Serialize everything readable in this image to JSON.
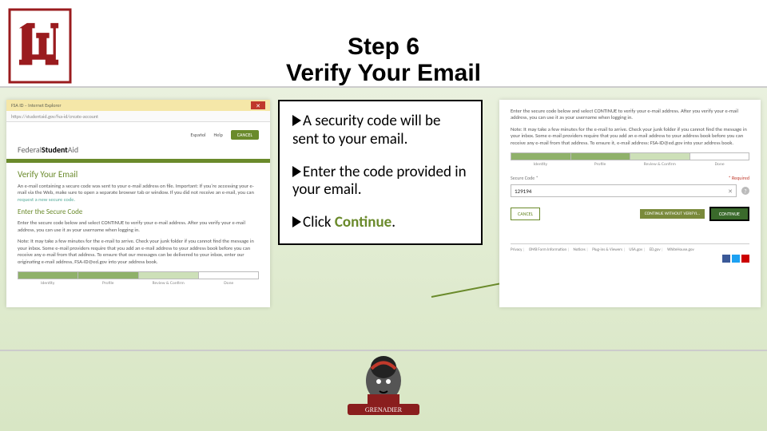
{
  "header": {
    "step": "Step 6",
    "title": "Verify Your Email"
  },
  "bullets": {
    "b1": "A security code will be sent to your email.",
    "b2": "Enter the code provided in your email.",
    "b3_prefix": "Click ",
    "b3_action": "Continue",
    "b3_suffix": "."
  },
  "left": {
    "browser_title": "FSA ID – Internet Explorer",
    "url": "https://studentaid.gov/fsa-id/create-account",
    "nav_espanol": "Español",
    "nav_help": "Help",
    "nav_cancel": "CANCEL",
    "brand_a": "Federal",
    "brand_b": "Student",
    "brand_c": "Aid",
    "h1": "Verify Your Email",
    "p1": "An e-mail containing a secure code was sent to your e-mail address on file. Important: If you're accessing your e-mail via the Web, make sure to open a separate browser tab or window. If you did not receive an e-mail, you can ",
    "p1_link": "request a new secure code.",
    "h2": "Enter the Secure Code",
    "p2": "Enter the secure code below and select CONTINUE to verify your e-mail address. After you verify your e-mail address, you can use it as your username when logging in.",
    "p3": "Note: It may take a few minutes for the e-mail to arrive. Check your junk folder if you cannot find the message in your inbox. Some e-mail providers require that you add an e-mail address to your address book before you can receive any e-mail from that address. To ensure that our messages can be delivered to your inbox, enter our originating e-mail address, FSA-ID@ed.gov into your address book.",
    "prog": {
      "a": "Identity",
      "b": "Profile",
      "c": "Review & Confirm",
      "d": "Done"
    }
  },
  "right": {
    "intro": "Enter the secure code below and select CONTINUE to verify your e-mail address. After you verify your e-mail address, you can use it as your username when logging in.",
    "note": "Note: It may take a few minutes for the e-mail to arrive. Check your junk folder if you cannot find the message in your inbox. Some e-mail providers require that you add an e-mail address to your address book before you can receive any e-mail from that address. To ensure it, e-mail address: FSA-ID@ed.gov into your address book.",
    "prog": {
      "a": "Identity",
      "b": "Profile",
      "c": "Review & Confirm",
      "d": "Done"
    },
    "label": "Secure Code *",
    "required": "* Required",
    "value": "129194",
    "btn_cancel": "CANCEL",
    "btn_skip": "CONTINUE WITHOUT VERIFYI…",
    "btn_continue": "CONTINUE",
    "footer": [
      "Privacy",
      "OMB Form Information",
      "Notices",
      "Plug-ins & Viewers",
      "USA.gov",
      "ED.gov",
      "WhiteHouse.gov"
    ]
  }
}
